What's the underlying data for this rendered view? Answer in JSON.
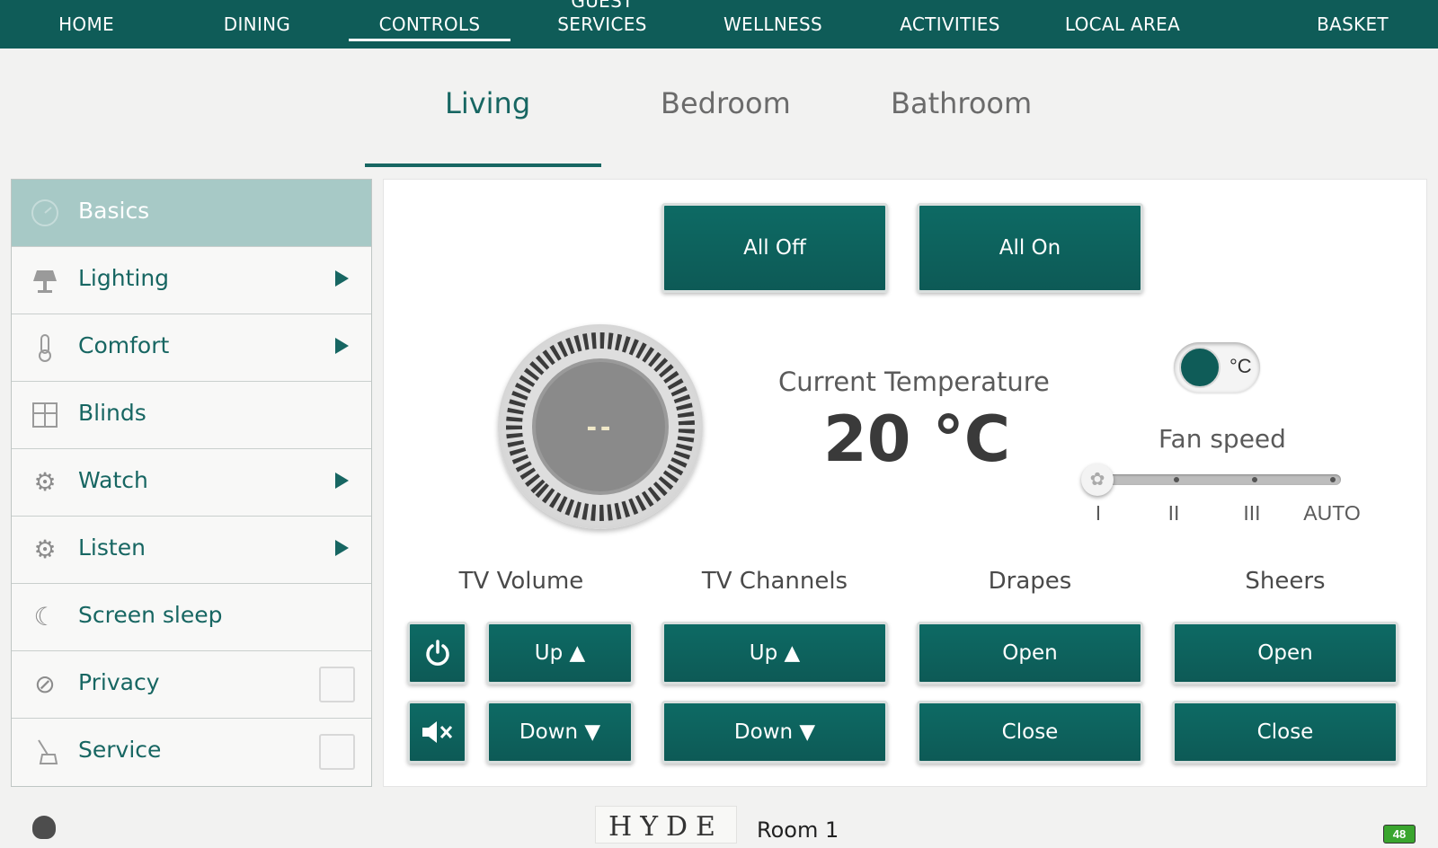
{
  "topnav": {
    "items": [
      {
        "label": "HOME"
      },
      {
        "label": "DINING"
      },
      {
        "label": "CONTROLS",
        "active": true
      },
      {
        "label": "GUEST SERVICES"
      },
      {
        "label": "WELLNESS"
      },
      {
        "label": "ACTIVITIES"
      },
      {
        "label": "LOCAL AREA"
      },
      {
        "label": "BASKET"
      }
    ]
  },
  "rooms": {
    "tabs": [
      {
        "label": "Living",
        "active": true
      },
      {
        "label": "Bedroom"
      },
      {
        "label": "Bathroom"
      }
    ]
  },
  "sidebar": {
    "items": [
      {
        "label": "Basics",
        "icon": "gauge-icon",
        "active": true
      },
      {
        "label": "Lighting",
        "icon": "lamp-icon",
        "submenu": true
      },
      {
        "label": "Comfort",
        "icon": "thermometer-icon",
        "submenu": true
      },
      {
        "label": "Blinds",
        "icon": "window-blinds-icon"
      },
      {
        "label": "Watch",
        "icon": "gear-icon",
        "submenu": true
      },
      {
        "label": "Listen",
        "icon": "gear-icon",
        "submenu": true
      },
      {
        "label": "Screen sleep",
        "icon": "moon-icon"
      },
      {
        "label": "Privacy",
        "icon": "no-entry-icon",
        "checkbox": true
      },
      {
        "label": "Service",
        "icon": "broom-icon",
        "checkbox": true
      }
    ]
  },
  "main": {
    "all_off": "All Off",
    "all_on": "All On",
    "dial_display": "--",
    "current_temp_label": "Current Temperature",
    "current_temp_value": "20 °C",
    "unit_toggle": "°C",
    "fan_speed_label": "Fan speed",
    "fan_levels": [
      "I",
      "II",
      "III",
      "AUTO"
    ],
    "fan_selected": "I",
    "tv_volume": {
      "label": "TV Volume",
      "up": "Up ▲",
      "down": "Down ▼"
    },
    "tv_channels": {
      "label": "TV Channels",
      "up": "Up ▲",
      "down": "Down ▼"
    },
    "drapes": {
      "label": "Drapes",
      "open": "Open",
      "close": "Close"
    },
    "sheers": {
      "label": "Sheers",
      "open": "Open",
      "close": "Close"
    }
  },
  "footer": {
    "logo": "HYDE",
    "room": "Room 1",
    "battery": "48"
  },
  "colors": {
    "brand": "#0f5c58",
    "accent": "#176662",
    "sidebar_active": "#a7c9c6"
  }
}
